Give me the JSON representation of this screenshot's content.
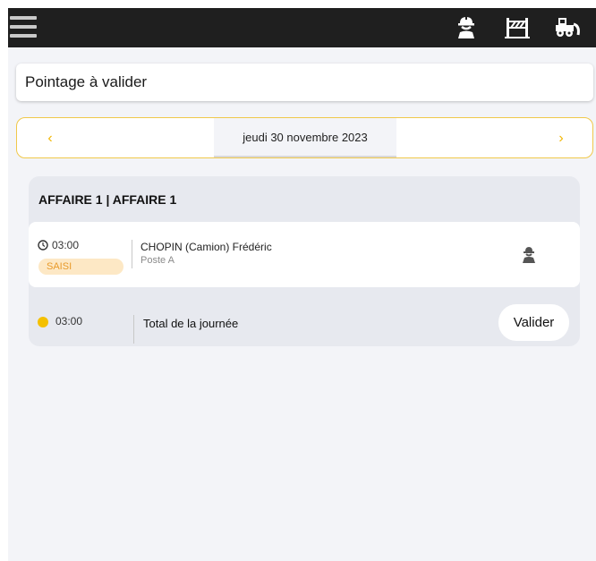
{
  "topbar": {
    "icons": [
      "worker-icon",
      "barrier-icon",
      "machine-icon"
    ],
    "background": "#1f1f1f"
  },
  "page_title": "Pointage à valider",
  "date_nav": {
    "prev_icon": "chevron-left-icon",
    "label": "jeudi 30 novembre 2023",
    "next_icon": "chevron-right-icon",
    "accent": "#f2b705"
  },
  "affaire": {
    "title": "AFFAIRE 1 | AFFAIRE 1",
    "entries": [
      {
        "time": "03:00",
        "status": "SAISI",
        "name": "CHOPIN (Camion) Frédéric",
        "poste": "Poste A",
        "icon": "worker-icon"
      }
    ],
    "total": {
      "time": "03:00",
      "label": "Total de la journée",
      "button": "Valider"
    }
  },
  "colors": {
    "status_badge_bg": "#fde8c5",
    "status_badge_text": "#e89a2a",
    "total_dot": "#f4c000"
  }
}
